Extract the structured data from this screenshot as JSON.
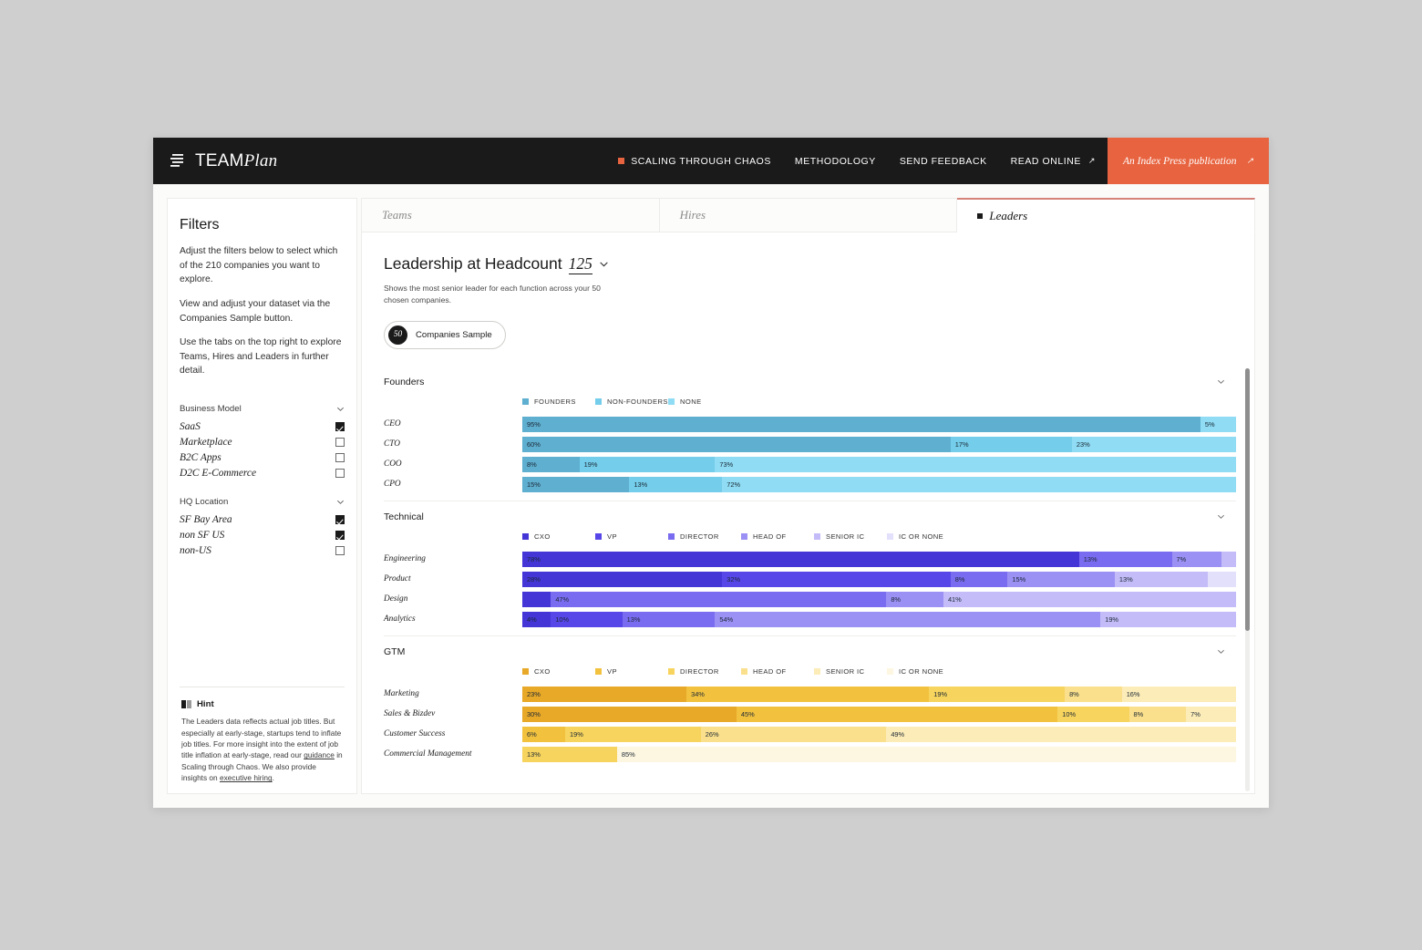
{
  "header": {
    "brand_team": "TEAM",
    "brand_plan": "Plan",
    "menu_icon": "hamburger-lines-icon",
    "nav": [
      {
        "label": "SCALING THROUGH CHAOS",
        "marker": true,
        "external": false
      },
      {
        "label": "METHODOLOGY",
        "marker": false,
        "external": false
      },
      {
        "label": "SEND FEEDBACK",
        "marker": false,
        "external": false
      },
      {
        "label": "READ ONLINE",
        "marker": false,
        "external": true
      }
    ],
    "cta": {
      "label": "An Index Press publication",
      "arrow": "↗"
    },
    "accent_color": "#e8633f"
  },
  "sidebar": {
    "title": "Filters",
    "paragraphs": [
      "Adjust the filters below to select which of the 210 companies you want to explore.",
      "View and adjust your dataset via the Companies Sample button.",
      "Use the tabs on the top right to explore Teams, Hires and Leaders in further detail."
    ],
    "groups": [
      {
        "title": "Business Model",
        "options": [
          {
            "label": "SaaS",
            "checked": true
          },
          {
            "label": "Marketplace",
            "checked": false
          },
          {
            "label": "B2C Apps",
            "checked": false
          },
          {
            "label": "D2C E-Commerce",
            "checked": false
          }
        ]
      },
      {
        "title": "HQ Location",
        "options": [
          {
            "label": "SF Bay Area",
            "checked": true
          },
          {
            "label": "non SF US",
            "checked": true
          },
          {
            "label": "non-US",
            "checked": false
          }
        ]
      }
    ],
    "hint": {
      "title": "Hint",
      "icon": "book-icon",
      "text_1": "The Leaders data reflects actual job titles. But especially at early-stage, startups tend to inflate job titles. For more insight into the extent of job title inflation at early-stage, read our ",
      "link_1": "guidance",
      "text_2": " in Scaling through Chaos. We also provide insights on ",
      "link_2": "executive hiring",
      "text_3": "."
    }
  },
  "tabs": [
    {
      "label": "Teams",
      "active": false
    },
    {
      "label": "Hires",
      "active": false
    },
    {
      "label": "Leaders",
      "active": true
    }
  ],
  "main": {
    "title_prefix": "Leadership at Headcount",
    "title_value": "125",
    "title_chevron": "chevron-down-icon",
    "subtitle": "Shows the most senior leader for each function across your 50 chosen companies.",
    "sample_button": {
      "count": "50",
      "label": "Companies Sample"
    }
  },
  "chart_data": [
    {
      "type": "bar",
      "title": "Founders",
      "orientation": "horizontal",
      "stacked": true,
      "units": "percent",
      "xlim": [
        0,
        100
      ],
      "grid": false,
      "legend_position": "top",
      "legend": [
        {
          "name": "FOUNDERS",
          "color": "#5fafd0"
        },
        {
          "name": "NON-FOUNDERS",
          "color": "#74cdea"
        },
        {
          "name": "NONE",
          "color": "#8fdcf4"
        }
      ],
      "categories": [
        "CEO",
        "CTO",
        "COO",
        "CPO"
      ],
      "series": [
        {
          "name": "FOUNDERS",
          "color": "#5fafd0",
          "values": [
            95,
            60,
            8,
            15
          ]
        },
        {
          "name": "NON-FOUNDERS",
          "color": "#74cdea",
          "values": [
            0,
            17,
            19,
            13
          ]
        },
        {
          "name": "NONE",
          "color": "#8fdcf4",
          "values": [
            5,
            23,
            73,
            72
          ]
        }
      ],
      "rows": [
        {
          "label": "CEO",
          "segments": [
            {
              "value": 95,
              "label": "95%",
              "color": "#5fafd0"
            },
            {
              "value": 5,
              "label": "5%",
              "color": "#8fdcf4"
            }
          ]
        },
        {
          "label": "CTO",
          "segments": [
            {
              "value": 60,
              "label": "60%",
              "color": "#5fafd0"
            },
            {
              "value": 17,
              "label": "17%",
              "color": "#74cdea"
            },
            {
              "value": 23,
              "label": "23%",
              "color": "#8fdcf4"
            }
          ]
        },
        {
          "label": "COO",
          "segments": [
            {
              "value": 8,
              "label": "8%",
              "color": "#5fafd0"
            },
            {
              "value": 19,
              "label": "19%",
              "color": "#74cdea"
            },
            {
              "value": 73,
              "label": "73%",
              "color": "#8fdcf4"
            }
          ]
        },
        {
          "label": "CPO",
          "segments": [
            {
              "value": 15,
              "label": "15%",
              "color": "#5fafd0"
            },
            {
              "value": 13,
              "label": "13%",
              "color": "#74cdea"
            },
            {
              "value": 72,
              "label": "72%",
              "color": "#8fdcf4"
            }
          ]
        }
      ]
    },
    {
      "type": "bar",
      "title": "Technical",
      "orientation": "horizontal",
      "stacked": true,
      "units": "percent",
      "xlim": [
        0,
        100
      ],
      "grid": false,
      "legend_position": "top",
      "legend": [
        {
          "name": "CXO",
          "color": "#4436d6"
        },
        {
          "name": "VP",
          "color": "#5747e8"
        },
        {
          "name": "DIRECTOR",
          "color": "#7a6cf0"
        },
        {
          "name": "HEAD OF",
          "color": "#9b90f4"
        },
        {
          "name": "SENIOR IC",
          "color": "#c3bcf8"
        },
        {
          "name": "IC OR NONE",
          "color": "#e3e0fc"
        }
      ],
      "categories": [
        "Engineering",
        "Product",
        "Design",
        "Analytics"
      ],
      "series": [
        {
          "name": "CXO",
          "color": "#4436d6",
          "values": [
            78,
            28,
            4,
            4
          ]
        },
        {
          "name": "VP",
          "color": "#5747e8",
          "values": [
            0,
            32,
            47,
            10
          ]
        },
        {
          "name": "DIRECTOR",
          "color": "#7a6cf0",
          "values": [
            13,
            8,
            0,
            13
          ]
        },
        {
          "name": "HEAD OF",
          "color": "#9b90f4",
          "values": [
            0,
            15,
            8,
            54
          ]
        },
        {
          "name": "SENIOR IC",
          "color": "#c3bcf8",
          "values": [
            7,
            13,
            41,
            19
          ]
        },
        {
          "name": "IC OR NONE",
          "color": "#e3e0fc",
          "values": [
            2,
            4,
            0,
            0
          ]
        }
      ],
      "rows": [
        {
          "label": "Engineering",
          "segments": [
            {
              "value": 78,
              "label": "78%",
              "color": "#4436d6"
            },
            {
              "value": 13,
              "label": "13%",
              "color": "#7a6cf0"
            },
            {
              "value": 7,
              "label": "7%",
              "color": "#9b90f4"
            },
            {
              "value": 2,
              "label": "",
              "color": "#c3bcf8"
            }
          ]
        },
        {
          "label": "Product",
          "segments": [
            {
              "value": 28,
              "label": "28%",
              "color": "#4436d6"
            },
            {
              "value": 32,
              "label": "32%",
              "color": "#5747e8"
            },
            {
              "value": 8,
              "label": "8%",
              "color": "#7a6cf0"
            },
            {
              "value": 15,
              "label": "15%",
              "color": "#9b90f4"
            },
            {
              "value": 13,
              "label": "13%",
              "color": "#c3bcf8"
            },
            {
              "value": 4,
              "label": "",
              "color": "#e3e0fc"
            }
          ]
        },
        {
          "label": "Design",
          "segments": [
            {
              "value": 4,
              "label": "",
              "color": "#4436d6"
            },
            {
              "value": 47,
              "label": "47%",
              "color": "#7a6cf0"
            },
            {
              "value": 8,
              "label": "8%",
              "color": "#9b90f4"
            },
            {
              "value": 41,
              "label": "41%",
              "color": "#c3bcf8"
            }
          ]
        },
        {
          "label": "Analytics",
          "segments": [
            {
              "value": 4,
              "label": "4%",
              "color": "#4436d6"
            },
            {
              "value": 10,
              "label": "10%",
              "color": "#5747e8"
            },
            {
              "value": 13,
              "label": "13%",
              "color": "#7a6cf0"
            },
            {
              "value": 54,
              "label": "54%",
              "color": "#9b90f4"
            },
            {
              "value": 19,
              "label": "19%",
              "color": "#c3bcf8"
            }
          ]
        }
      ]
    },
    {
      "type": "bar",
      "title": "GTM",
      "orientation": "horizontal",
      "stacked": true,
      "units": "percent",
      "xlim": [
        0,
        100
      ],
      "grid": false,
      "legend_position": "top",
      "legend": [
        {
          "name": "CXO",
          "color": "#e8a828"
        },
        {
          "name": "VP",
          "color": "#f2c23f"
        },
        {
          "name": "DIRECTOR",
          "color": "#f7d45e"
        },
        {
          "name": "HEAD OF",
          "color": "#fae08c"
        },
        {
          "name": "SENIOR IC",
          "color": "#fcecb8"
        },
        {
          "name": "IC OR NONE",
          "color": "#fdf6e0"
        }
      ],
      "categories": [
        "Marketing",
        "Sales & Bizdev",
        "Customer Success",
        "Commercial Management"
      ],
      "series": [
        {
          "name": "CXO",
          "color": "#e8a828",
          "values": [
            23,
            30,
            6,
            13
          ]
        },
        {
          "name": "VP",
          "color": "#f2c23f",
          "values": [
            34,
            45,
            19,
            0
          ]
        },
        {
          "name": "DIRECTOR",
          "color": "#f7d45e",
          "values": [
            19,
            10,
            26,
            0
          ]
        },
        {
          "name": "HEAD OF",
          "color": "#fae08c",
          "values": [
            8,
            8,
            49,
            0
          ]
        },
        {
          "name": "SENIOR IC",
          "color": "#fcecb8",
          "values": [
            16,
            7,
            0,
            85
          ]
        }
      ],
      "rows": [
        {
          "label": "Marketing",
          "segments": [
            {
              "value": 23,
              "label": "23%",
              "color": "#e8a828"
            },
            {
              "value": 34,
              "label": "34%",
              "color": "#f2c23f"
            },
            {
              "value": 19,
              "label": "19%",
              "color": "#f7d45e"
            },
            {
              "value": 8,
              "label": "8%",
              "color": "#fae08c"
            },
            {
              "value": 16,
              "label": "16%",
              "color": "#fcecb8"
            }
          ]
        },
        {
          "label": "Sales & Bizdev",
          "segments": [
            {
              "value": 30,
              "label": "30%",
              "color": "#e8a828"
            },
            {
              "value": 45,
              "label": "45%",
              "color": "#f2c23f"
            },
            {
              "value": 10,
              "label": "10%",
              "color": "#f7d45e"
            },
            {
              "value": 8,
              "label": "8%",
              "color": "#fae08c"
            },
            {
              "value": 7,
              "label": "7%",
              "color": "#fcecb8"
            }
          ]
        },
        {
          "label": "Customer Success",
          "segments": [
            {
              "value": 6,
              "label": "6%",
              "color": "#f2c23f"
            },
            {
              "value": 19,
              "label": "19%",
              "color": "#f7d45e"
            },
            {
              "value": 26,
              "label": "26%",
              "color": "#fae08c"
            },
            {
              "value": 49,
              "label": "49%",
              "color": "#fcecb8"
            }
          ]
        },
        {
          "label": "Commercial Management",
          "segments": [
            {
              "value": 13,
              "label": "13%",
              "color": "#f7d45e"
            },
            {
              "value": 85,
              "label": "85%",
              "color": "#fdf6e0"
            }
          ]
        }
      ]
    }
  ],
  "scrollbar": {
    "thumb_percent": 62
  }
}
